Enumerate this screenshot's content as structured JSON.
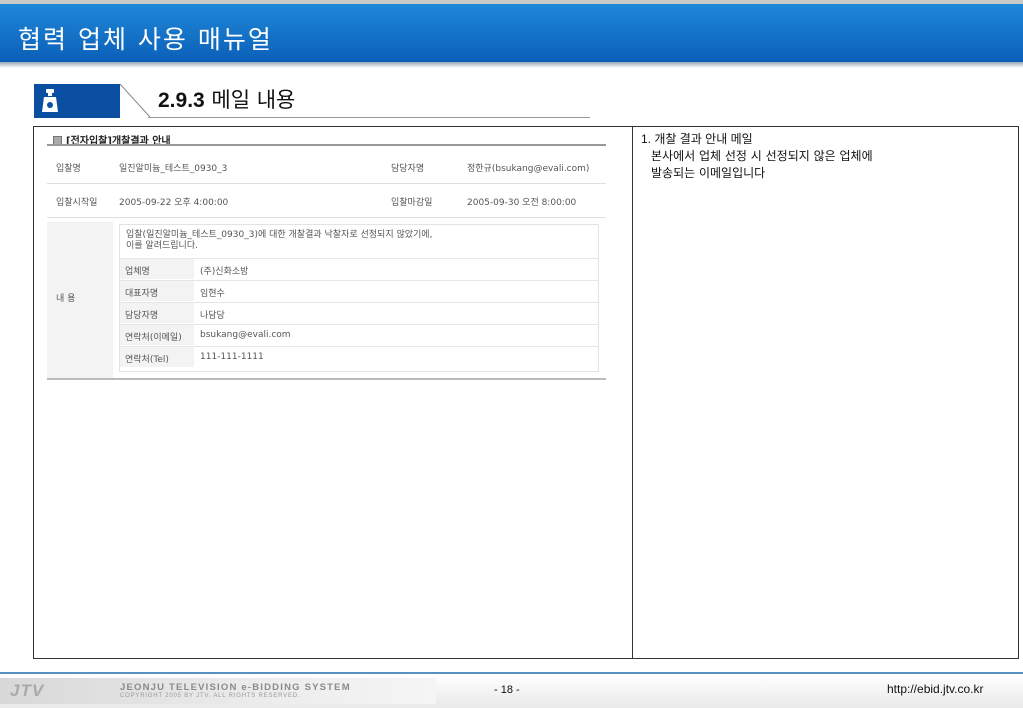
{
  "header": {
    "title": "협력 업체 사용 매뉴얼"
  },
  "section": {
    "number": "2.9.3",
    "title": "메일 내용"
  },
  "mail": {
    "heading": "[전자입찰]개찰결과 안내",
    "rows": [
      {
        "label1": "입찰명",
        "value1": "일진알미늄_테스트_0930_3",
        "label2": "담당자명",
        "value2": "정한규(bsukang@evali.com)"
      },
      {
        "label1": "입찰시작일",
        "value1": "2005-09-22 오후 4:00:00",
        "label2": "입찰마감일",
        "value2": "2005-09-30 오전 8:00:00"
      }
    ],
    "content_label": "내 용",
    "message_line1": "입찰(일진알미늄_테스트_0930_3)에 대한 개찰결과 낙찰자로 선정되지 않았기에,",
    "message_line2": "이를 알려드립니다.",
    "details": [
      {
        "key": "업체명",
        "value": "(주)신화소방"
      },
      {
        "key": "대표자명",
        "value": "임현수"
      },
      {
        "key": "담당자명",
        "value": "나담당"
      },
      {
        "key": "연락처(이메일)",
        "value": "bsukang@evali.com"
      },
      {
        "key": "연락처(Tel)",
        "value": "111-111-1111"
      }
    ]
  },
  "description": {
    "heading": "1. 개찰 결과 안내 메일",
    "line1": "본사에서 업체 선정 시 선정되지 않은 업체에",
    "line2": "발송되는 이메일입니다"
  },
  "footer": {
    "logo": "JTV",
    "system_name": "JEONJU TELEVISION e-BIDDING SYSTEM",
    "copyright": "COPYRIGHT 2005 BY JTV. ALL RIGHTS RESERVED.",
    "page": "- 18 -",
    "url": "http://ebid.jtv.co.kr"
  }
}
